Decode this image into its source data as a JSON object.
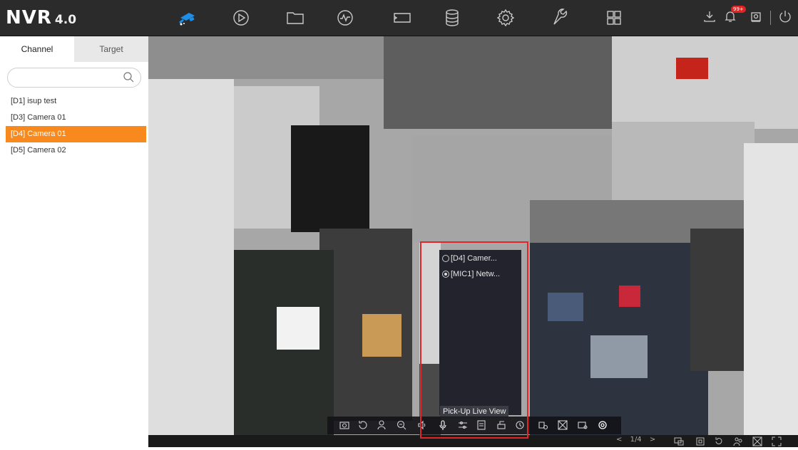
{
  "app": {
    "logo": "NVR",
    "version": "4.0",
    "notification_badge": "99+"
  },
  "nav_icons": [
    "live-view-camera-icon",
    "playback-icon",
    "file-folder-icon",
    "smart-analysis-icon",
    "tag-icon",
    "storage-icon",
    "settings-gear-icon",
    "maintenance-wrench-icon",
    "multi-window-icon"
  ],
  "sidebar": {
    "tabs": [
      {
        "label": "Channel"
      },
      {
        "label": "Target"
      }
    ],
    "search": {
      "value": "",
      "placeholder": ""
    },
    "channels": [
      {
        "label": "[D1] isup test"
      },
      {
        "label": "[D3] Camera 01"
      },
      {
        "label": "[D4] Camera 01"
      },
      {
        "label": "[D5] Camera 02"
      }
    ],
    "selected_channel": "[D4] Camera 01"
  },
  "pickup_popup": {
    "options": [
      {
        "label": "[D4] Camer...",
        "selected": false
      },
      {
        "label": "[MIC1] Netw...",
        "selected": true
      }
    ],
    "tooltip": "Pick-Up Live View"
  },
  "pager": {
    "text": "1/4"
  },
  "colors": {
    "topbar": "#2b2b2b",
    "accent": "#f7891e",
    "active_nav": "#1e8fe8",
    "highlight_box": "#e0262a"
  }
}
